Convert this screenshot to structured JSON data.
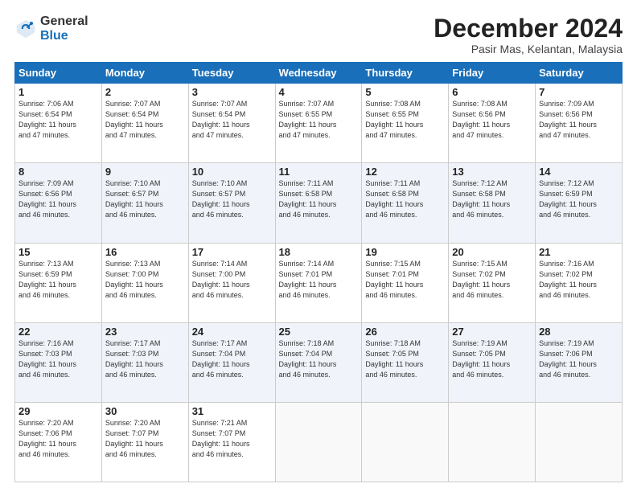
{
  "header": {
    "logo_general": "General",
    "logo_blue": "Blue",
    "month_title": "December 2024",
    "location": "Pasir Mas, Kelantan, Malaysia"
  },
  "days_of_week": [
    "Sunday",
    "Monday",
    "Tuesday",
    "Wednesday",
    "Thursday",
    "Friday",
    "Saturday"
  ],
  "weeks": [
    [
      {
        "day": "1",
        "info": "Sunrise: 7:06 AM\nSunset: 6:54 PM\nDaylight: 11 hours\nand 47 minutes."
      },
      {
        "day": "2",
        "info": "Sunrise: 7:07 AM\nSunset: 6:54 PM\nDaylight: 11 hours\nand 47 minutes."
      },
      {
        "day": "3",
        "info": "Sunrise: 7:07 AM\nSunset: 6:54 PM\nDaylight: 11 hours\nand 47 minutes."
      },
      {
        "day": "4",
        "info": "Sunrise: 7:07 AM\nSunset: 6:55 PM\nDaylight: 11 hours\nand 47 minutes."
      },
      {
        "day": "5",
        "info": "Sunrise: 7:08 AM\nSunset: 6:55 PM\nDaylight: 11 hours\nand 47 minutes."
      },
      {
        "day": "6",
        "info": "Sunrise: 7:08 AM\nSunset: 6:56 PM\nDaylight: 11 hours\nand 47 minutes."
      },
      {
        "day": "7",
        "info": "Sunrise: 7:09 AM\nSunset: 6:56 PM\nDaylight: 11 hours\nand 47 minutes."
      }
    ],
    [
      {
        "day": "8",
        "info": "Sunrise: 7:09 AM\nSunset: 6:56 PM\nDaylight: 11 hours\nand 46 minutes."
      },
      {
        "day": "9",
        "info": "Sunrise: 7:10 AM\nSunset: 6:57 PM\nDaylight: 11 hours\nand 46 minutes."
      },
      {
        "day": "10",
        "info": "Sunrise: 7:10 AM\nSunset: 6:57 PM\nDaylight: 11 hours\nand 46 minutes."
      },
      {
        "day": "11",
        "info": "Sunrise: 7:11 AM\nSunset: 6:58 PM\nDaylight: 11 hours\nand 46 minutes."
      },
      {
        "day": "12",
        "info": "Sunrise: 7:11 AM\nSunset: 6:58 PM\nDaylight: 11 hours\nand 46 minutes."
      },
      {
        "day": "13",
        "info": "Sunrise: 7:12 AM\nSunset: 6:58 PM\nDaylight: 11 hours\nand 46 minutes."
      },
      {
        "day": "14",
        "info": "Sunrise: 7:12 AM\nSunset: 6:59 PM\nDaylight: 11 hours\nand 46 minutes."
      }
    ],
    [
      {
        "day": "15",
        "info": "Sunrise: 7:13 AM\nSunset: 6:59 PM\nDaylight: 11 hours\nand 46 minutes."
      },
      {
        "day": "16",
        "info": "Sunrise: 7:13 AM\nSunset: 7:00 PM\nDaylight: 11 hours\nand 46 minutes."
      },
      {
        "day": "17",
        "info": "Sunrise: 7:14 AM\nSunset: 7:00 PM\nDaylight: 11 hours\nand 46 minutes."
      },
      {
        "day": "18",
        "info": "Sunrise: 7:14 AM\nSunset: 7:01 PM\nDaylight: 11 hours\nand 46 minutes."
      },
      {
        "day": "19",
        "info": "Sunrise: 7:15 AM\nSunset: 7:01 PM\nDaylight: 11 hours\nand 46 minutes."
      },
      {
        "day": "20",
        "info": "Sunrise: 7:15 AM\nSunset: 7:02 PM\nDaylight: 11 hours\nand 46 minutes."
      },
      {
        "day": "21",
        "info": "Sunrise: 7:16 AM\nSunset: 7:02 PM\nDaylight: 11 hours\nand 46 minutes."
      }
    ],
    [
      {
        "day": "22",
        "info": "Sunrise: 7:16 AM\nSunset: 7:03 PM\nDaylight: 11 hours\nand 46 minutes."
      },
      {
        "day": "23",
        "info": "Sunrise: 7:17 AM\nSunset: 7:03 PM\nDaylight: 11 hours\nand 46 minutes."
      },
      {
        "day": "24",
        "info": "Sunrise: 7:17 AM\nSunset: 7:04 PM\nDaylight: 11 hours\nand 46 minutes."
      },
      {
        "day": "25",
        "info": "Sunrise: 7:18 AM\nSunset: 7:04 PM\nDaylight: 11 hours\nand 46 minutes."
      },
      {
        "day": "26",
        "info": "Sunrise: 7:18 AM\nSunset: 7:05 PM\nDaylight: 11 hours\nand 46 minutes."
      },
      {
        "day": "27",
        "info": "Sunrise: 7:19 AM\nSunset: 7:05 PM\nDaylight: 11 hours\nand 46 minutes."
      },
      {
        "day": "28",
        "info": "Sunrise: 7:19 AM\nSunset: 7:06 PM\nDaylight: 11 hours\nand 46 minutes."
      }
    ],
    [
      {
        "day": "29",
        "info": "Sunrise: 7:20 AM\nSunset: 7:06 PM\nDaylight: 11 hours\nand 46 minutes."
      },
      {
        "day": "30",
        "info": "Sunrise: 7:20 AM\nSunset: 7:07 PM\nDaylight: 11 hours\nand 46 minutes."
      },
      {
        "day": "31",
        "info": "Sunrise: 7:21 AM\nSunset: 7:07 PM\nDaylight: 11 hours\nand 46 minutes."
      },
      null,
      null,
      null,
      null
    ]
  ]
}
